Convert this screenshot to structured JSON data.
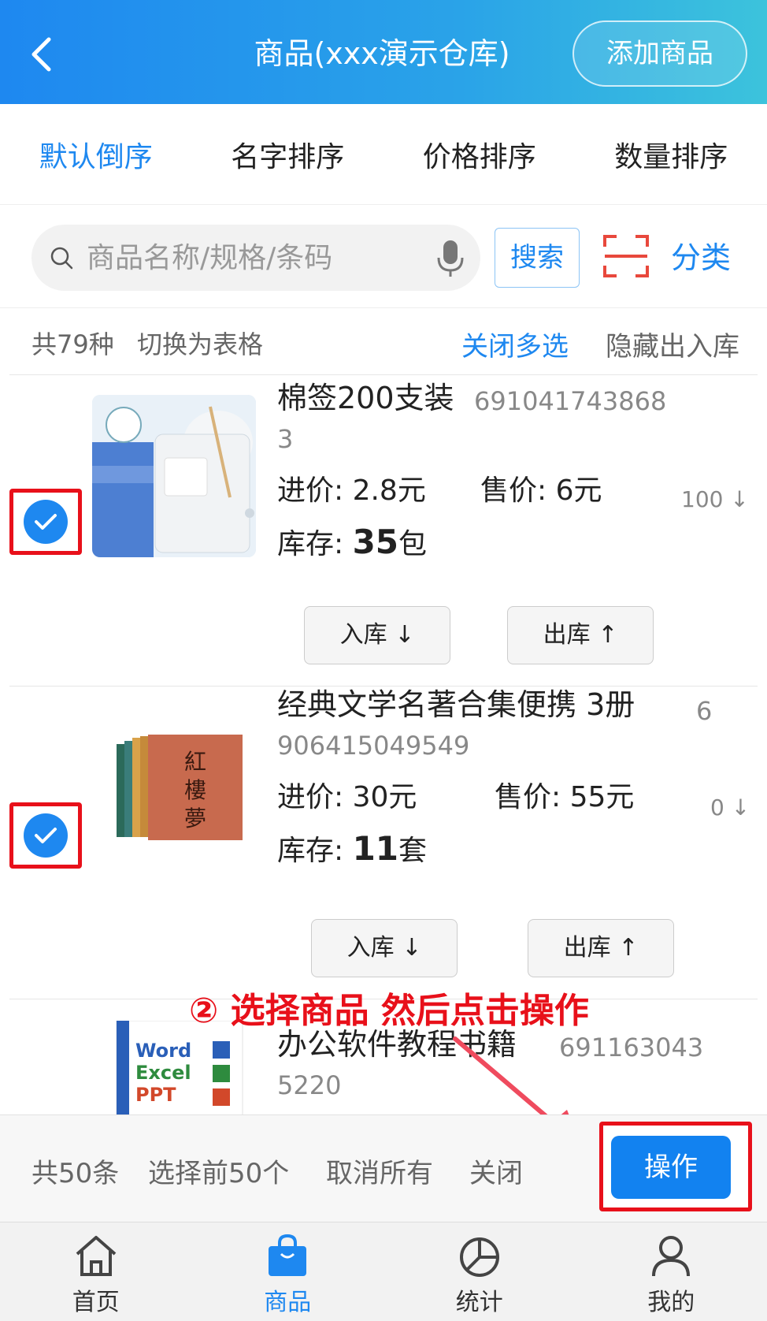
{
  "header": {
    "title": "商品(xxx演示仓库)",
    "add_button": "添加商品"
  },
  "sort_tabs": [
    {
      "label": "默认倒序",
      "active": true
    },
    {
      "label": "名字排序",
      "active": false
    },
    {
      "label": "价格排序",
      "active": false
    },
    {
      "label": "数量排序",
      "active": false
    }
  ],
  "search": {
    "placeholder": "商品名称/规格/条码",
    "button": "搜索",
    "category": "分类"
  },
  "info": {
    "count": "共79种",
    "switch_view": "切换为表格",
    "close_multi": "关闭多选",
    "hide_inout": "隐藏出入库"
  },
  "items": [
    {
      "name": "棉签200支装",
      "barcode_line1": "691041743868",
      "barcode_line2": "3",
      "cost": "进价: 2.8元",
      "sale": "售价: 6元",
      "stock_label": "库存: ",
      "stock_num": "35",
      "stock_unit": "包",
      "right_count": "100 ↓",
      "in_button": "入库 ↓",
      "out_button": "出库 ↑",
      "checked": true
    },
    {
      "name": "经典文学名著合集便携  3册",
      "barcode_line1": "6",
      "barcode_line2": "906415049549",
      "cost": "进价: 30元",
      "sale": "售价: 55元",
      "stock_label": "库存: ",
      "stock_num": "11",
      "stock_unit": "套",
      "right_count": "0 ↓",
      "in_button": "入库 ↓",
      "out_button": "出库 ↑",
      "checked": true
    },
    {
      "name": "办公软件教程书籍",
      "barcode_line1": "691163043",
      "barcode_line2": "5220"
    }
  ],
  "annotation": "② 选择商品 然后点击操作",
  "footer": {
    "total": "共50条",
    "select_first": "选择前50个",
    "cancel_all": "取消所有",
    "close": "关闭",
    "operate": "操作"
  },
  "tabs": [
    {
      "label": "首页",
      "icon": "home-icon",
      "active": false
    },
    {
      "label": "商品",
      "icon": "shopping-bag-icon",
      "active": true
    },
    {
      "label": "统计",
      "icon": "pie-chart-icon",
      "active": false
    },
    {
      "label": "我的",
      "icon": "user-icon",
      "active": false
    }
  ],
  "colors": {
    "accent": "#1e88f0",
    "highlight": "#e8101a"
  }
}
